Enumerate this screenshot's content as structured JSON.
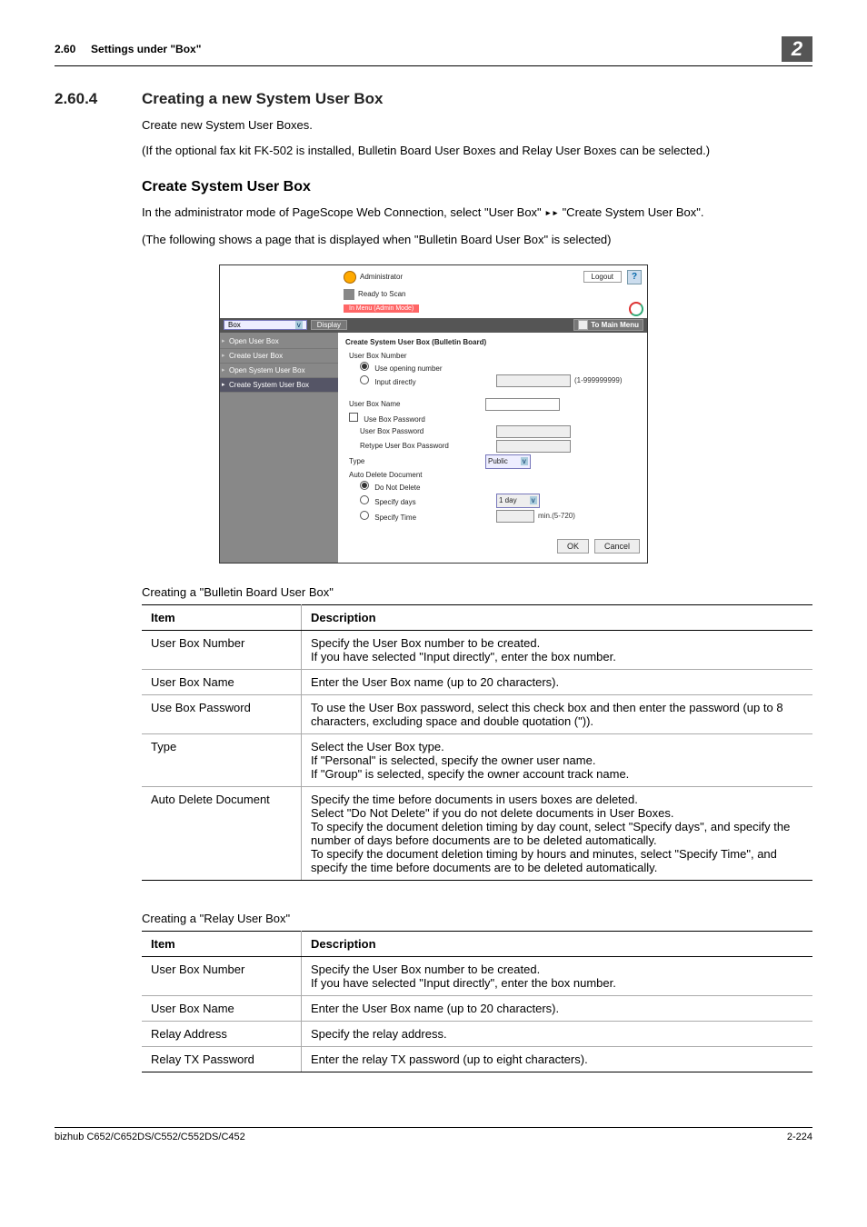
{
  "header": {
    "section_ref": "2.60",
    "section_title": "Settings under \"Box\"",
    "chapter_num": "2"
  },
  "heading": {
    "number": "2.60.4",
    "title": "Creating a new System User Box"
  },
  "paragraphs": {
    "intro1": "Create new System User Boxes.",
    "intro2": "(If the optional fax kit FK-502 is installed, Bulletin Board User Boxes and Relay User Boxes can be selected.)",
    "sub_heading": "Create System User Box",
    "sub_p1_a": "In the administrator mode of PageScope Web Connection, select \"User Box\" ",
    "sub_p1_arrow": "▸▸",
    "sub_p1_b": " \"Create System User Box\".",
    "sub_p2": "(The following shows a page that is displayed when \"Bulletin Board User Box\" is selected)"
  },
  "screenshot": {
    "admin_label": "Administrator",
    "logout": "Logout",
    "help": "?",
    "ready": "Ready to Scan",
    "mode": "In Menu (Admin Mode)",
    "dropdown": "Box",
    "display": "Display",
    "main_menu": "To Main Menu",
    "side": {
      "i1": "Open User Box",
      "i2": "Create User Box",
      "i3": "Open System User Box",
      "i4": "Create System User Box"
    },
    "form": {
      "title": "Create System User Box (Bulletin Board)",
      "ubn": "User Box Number",
      "opt_opening": "Use opening number",
      "opt_input": "Input directly",
      "range": "(1-999999999)",
      "ubname": "User Box Name",
      "usepw": "Use Box Password",
      "pw": "User Box Password",
      "repw": "Retype User Box Password",
      "type": "Type",
      "type_val": "Public",
      "autodel": "Auto Delete Document",
      "dnd": "Do Not Delete",
      "sd": "Specify days",
      "sd_val": "1 day",
      "st": "Specify Time",
      "st_range": "min.(5-720)",
      "ok": "OK",
      "cancel": "Cancel"
    }
  },
  "table1": {
    "caption": "Creating a \"Bulletin Board User Box\"",
    "h_item": "Item",
    "h_desc": "Description",
    "rows": [
      {
        "item": "User Box Number",
        "desc": "Specify the User Box number to be created.\nIf you have selected \"Input directly\", enter the box number."
      },
      {
        "item": "User Box Name",
        "desc": "Enter the User Box name (up to 20 characters)."
      },
      {
        "item": "Use Box Password",
        "desc": "To use the User Box password, select this check box and then enter the password (up to 8 characters, excluding space and double quotation (\"))."
      },
      {
        "item": "Type",
        "desc": "Select the User Box type.\nIf \"Personal\" is selected, specify the owner user name.\nIf \"Group\" is selected, specify the owner account track name."
      },
      {
        "item": "Auto Delete Document",
        "desc": "Specify the time before documents in users boxes are deleted.\nSelect \"Do Not Delete\" if you do not delete documents in User Boxes.\nTo specify the document deletion timing by day count, select \"Specify days\", and specify the number of days before documents are to be deleted automatically.\nTo specify the document deletion timing by hours and minutes, select \"Specify Time\", and specify the time before documents are to be deleted automatically."
      }
    ]
  },
  "table2": {
    "caption": "Creating a \"Relay User Box\"",
    "h_item": "Item",
    "h_desc": "Description",
    "rows": [
      {
        "item": "User Box Number",
        "desc": "Specify the User Box number to be created.\nIf you have selected \"Input directly\", enter the box number."
      },
      {
        "item": "User Box Name",
        "desc": "Enter the User Box name (up to 20 characters)."
      },
      {
        "item": "Relay Address",
        "desc": "Specify the relay address."
      },
      {
        "item": "Relay TX Password",
        "desc": "Enter the relay TX password (up to eight characters)."
      }
    ]
  },
  "footer": {
    "left": "bizhub C652/C652DS/C552/C552DS/C452",
    "right": "2-224"
  }
}
